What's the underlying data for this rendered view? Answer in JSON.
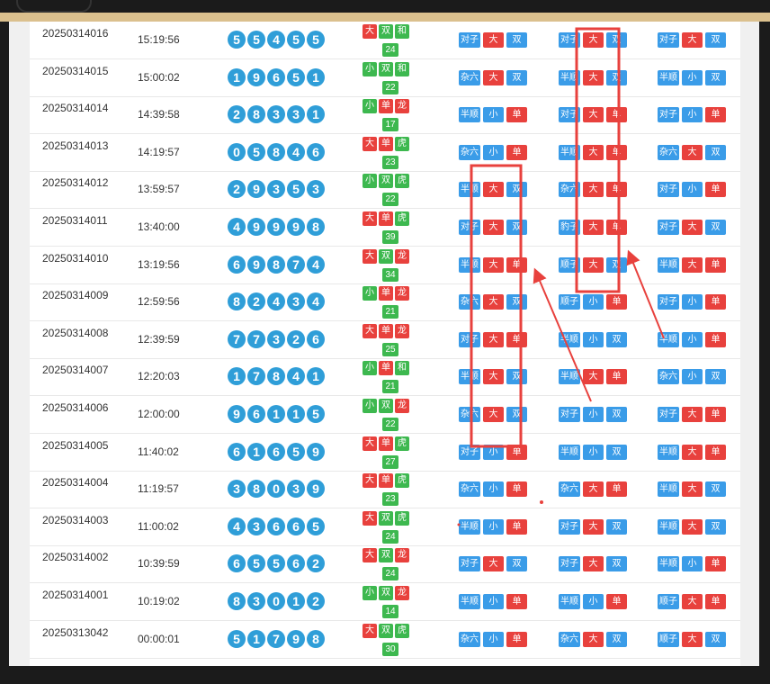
{
  "colors": {
    "red": "#e8413d",
    "blue": "#3a9ce8",
    "green": "#3db84f",
    "ball": "#2f9ed8",
    "highlight": "#e8413d"
  },
  "rows": [
    {
      "issue": "20250314016",
      "time": "15:19:56",
      "balls": [
        "5",
        "5",
        "4",
        "5",
        "5"
      ],
      "attr": [
        [
          "大",
          "red"
        ],
        [
          "双",
          "green"
        ],
        [
          "和",
          "green"
        ]
      ],
      "sum": "24",
      "g1": [
        [
          "对子",
          "blue"
        ],
        [
          "大",
          "red"
        ],
        [
          "双",
          "blue"
        ]
      ],
      "g2": [
        [
          "对子",
          "blue"
        ],
        [
          "大",
          "red"
        ],
        [
          "双",
          "blue"
        ]
      ],
      "g3": [
        [
          "对子",
          "blue"
        ],
        [
          "大",
          "red"
        ],
        [
          "双",
          "blue"
        ]
      ]
    },
    {
      "issue": "20250314015",
      "time": "15:00:02",
      "balls": [
        "1",
        "9",
        "6",
        "5",
        "1"
      ],
      "attr": [
        [
          "小",
          "green"
        ],
        [
          "双",
          "green"
        ],
        [
          "和",
          "green"
        ]
      ],
      "sum": "22",
      "g1": [
        [
          "杂六",
          "blue"
        ],
        [
          "大",
          "red"
        ],
        [
          "双",
          "blue"
        ]
      ],
      "g2": [
        [
          "半顺",
          "blue"
        ],
        [
          "大",
          "red"
        ],
        [
          "双",
          "blue"
        ]
      ],
      "g3": [
        [
          "半顺",
          "blue"
        ],
        [
          "小",
          "blue"
        ],
        [
          "双",
          "blue"
        ]
      ]
    },
    {
      "issue": "20250314014",
      "time": "14:39:58",
      "balls": [
        "2",
        "8",
        "3",
        "3",
        "1"
      ],
      "attr": [
        [
          "小",
          "green"
        ],
        [
          "单",
          "red"
        ],
        [
          "龙",
          "red"
        ]
      ],
      "sum": "17",
      "g1": [
        [
          "半顺",
          "blue"
        ],
        [
          "小",
          "blue"
        ],
        [
          "单",
          "red"
        ]
      ],
      "g2": [
        [
          "对子",
          "blue"
        ],
        [
          "大",
          "red"
        ],
        [
          "单",
          "red"
        ]
      ],
      "g3": [
        [
          "对子",
          "blue"
        ],
        [
          "小",
          "blue"
        ],
        [
          "单",
          "red"
        ]
      ]
    },
    {
      "issue": "20250314013",
      "time": "14:19:57",
      "balls": [
        "0",
        "5",
        "8",
        "4",
        "6"
      ],
      "attr": [
        [
          "大",
          "red"
        ],
        [
          "单",
          "red"
        ],
        [
          "虎",
          "green"
        ]
      ],
      "sum": "23",
      "g1": [
        [
          "杂六",
          "blue"
        ],
        [
          "小",
          "blue"
        ],
        [
          "单",
          "red"
        ]
      ],
      "g2": [
        [
          "半顺",
          "blue"
        ],
        [
          "大",
          "red"
        ],
        [
          "单",
          "red"
        ]
      ],
      "g3": [
        [
          "杂六",
          "blue"
        ],
        [
          "大",
          "red"
        ],
        [
          "双",
          "blue"
        ]
      ]
    },
    {
      "issue": "20250314012",
      "time": "13:59:57",
      "balls": [
        "2",
        "9",
        "3",
        "5",
        "3"
      ],
      "attr": [
        [
          "小",
          "green"
        ],
        [
          "双",
          "green"
        ],
        [
          "虎",
          "green"
        ]
      ],
      "sum": "22",
      "g1": [
        [
          "半顺",
          "blue"
        ],
        [
          "大",
          "red"
        ],
        [
          "双",
          "blue"
        ]
      ],
      "g2": [
        [
          "杂六",
          "blue"
        ],
        [
          "大",
          "red"
        ],
        [
          "单",
          "red"
        ]
      ],
      "g3": [
        [
          "对子",
          "blue"
        ],
        [
          "小",
          "blue"
        ],
        [
          "单",
          "red"
        ]
      ]
    },
    {
      "issue": "20250314011",
      "time": "13:40:00",
      "balls": [
        "4",
        "9",
        "9",
        "9",
        "8"
      ],
      "attr": [
        [
          "大",
          "red"
        ],
        [
          "单",
          "red"
        ],
        [
          "虎",
          "green"
        ]
      ],
      "sum": "39",
      "g1": [
        [
          "对子",
          "blue"
        ],
        [
          "大",
          "red"
        ],
        [
          "双",
          "blue"
        ]
      ],
      "g2": [
        [
          "豹子",
          "blue"
        ],
        [
          "大",
          "red"
        ],
        [
          "单",
          "red"
        ]
      ],
      "g3": [
        [
          "对子",
          "blue"
        ],
        [
          "大",
          "red"
        ],
        [
          "双",
          "blue"
        ]
      ]
    },
    {
      "issue": "20250314010",
      "time": "13:19:56",
      "balls": [
        "6",
        "9",
        "8",
        "7",
        "4"
      ],
      "attr": [
        [
          "大",
          "red"
        ],
        [
          "双",
          "green"
        ],
        [
          "龙",
          "red"
        ]
      ],
      "sum": "34",
      "g1": [
        [
          "半顺",
          "blue"
        ],
        [
          "大",
          "red"
        ],
        [
          "单",
          "red"
        ]
      ],
      "g2": [
        [
          "顺子",
          "blue"
        ],
        [
          "大",
          "red"
        ],
        [
          "双",
          "blue"
        ]
      ],
      "g3": [
        [
          "半顺",
          "blue"
        ],
        [
          "大",
          "red"
        ],
        [
          "单",
          "red"
        ]
      ]
    },
    {
      "issue": "20250314009",
      "time": "12:59:56",
      "balls": [
        "8",
        "2",
        "4",
        "3",
        "4"
      ],
      "attr": [
        [
          "小",
          "green"
        ],
        [
          "单",
          "red"
        ],
        [
          "龙",
          "red"
        ]
      ],
      "sum": "21",
      "g1": [
        [
          "杂六",
          "blue"
        ],
        [
          "大",
          "red"
        ],
        [
          "双",
          "blue"
        ]
      ],
      "g2": [
        [
          "顺子",
          "blue"
        ],
        [
          "小",
          "blue"
        ],
        [
          "单",
          "red"
        ]
      ],
      "g3": [
        [
          "对子",
          "blue"
        ],
        [
          "小",
          "blue"
        ],
        [
          "单",
          "red"
        ]
      ]
    },
    {
      "issue": "20250314008",
      "time": "12:39:59",
      "balls": [
        "7",
        "7",
        "3",
        "2",
        "6"
      ],
      "attr": [
        [
          "大",
          "red"
        ],
        [
          "单",
          "red"
        ],
        [
          "龙",
          "red"
        ]
      ],
      "sum": "25",
      "g1": [
        [
          "对子",
          "blue"
        ],
        [
          "大",
          "red"
        ],
        [
          "单",
          "red"
        ]
      ],
      "g2": [
        [
          "半顺",
          "blue"
        ],
        [
          "小",
          "blue"
        ],
        [
          "双",
          "blue"
        ]
      ],
      "g3": [
        [
          "半顺",
          "blue"
        ],
        [
          "小",
          "blue"
        ],
        [
          "单",
          "red"
        ]
      ]
    },
    {
      "issue": "20250314007",
      "time": "12:20:03",
      "balls": [
        "1",
        "7",
        "8",
        "4",
        "1"
      ],
      "attr": [
        [
          "小",
          "green"
        ],
        [
          "单",
          "red"
        ],
        [
          "和",
          "green"
        ]
      ],
      "sum": "21",
      "g1": [
        [
          "半顺",
          "blue"
        ],
        [
          "大",
          "red"
        ],
        [
          "双",
          "blue"
        ]
      ],
      "g2": [
        [
          "半顺",
          "blue"
        ],
        [
          "大",
          "red"
        ],
        [
          "单",
          "red"
        ]
      ],
      "g3": [
        [
          "杂六",
          "blue"
        ],
        [
          "小",
          "blue"
        ],
        [
          "双",
          "blue"
        ]
      ]
    },
    {
      "issue": "20250314006",
      "time": "12:00:00",
      "balls": [
        "9",
        "6",
        "1",
        "1",
        "5"
      ],
      "attr": [
        [
          "小",
          "green"
        ],
        [
          "双",
          "green"
        ],
        [
          "龙",
          "red"
        ]
      ],
      "sum": "22",
      "g1": [
        [
          "杂六",
          "blue"
        ],
        [
          "大",
          "red"
        ],
        [
          "双",
          "blue"
        ]
      ],
      "g2": [
        [
          "对子",
          "blue"
        ],
        [
          "小",
          "blue"
        ],
        [
          "双",
          "blue"
        ]
      ],
      "g3": [
        [
          "对子",
          "blue"
        ],
        [
          "大",
          "red"
        ],
        [
          "单",
          "red"
        ]
      ]
    },
    {
      "issue": "20250314005",
      "time": "11:40:02",
      "balls": [
        "6",
        "1",
        "6",
        "5",
        "9"
      ],
      "attr": [
        [
          "大",
          "red"
        ],
        [
          "单",
          "red"
        ],
        [
          "虎",
          "green"
        ]
      ],
      "sum": "27",
      "g1": [
        [
          "对子",
          "blue"
        ],
        [
          "小",
          "blue"
        ],
        [
          "单",
          "red"
        ]
      ],
      "g2": [
        [
          "半顺",
          "blue"
        ],
        [
          "小",
          "blue"
        ],
        [
          "双",
          "blue"
        ]
      ],
      "g3": [
        [
          "半顺",
          "blue"
        ],
        [
          "大",
          "red"
        ],
        [
          "单",
          "red"
        ]
      ]
    },
    {
      "issue": "20250314004",
      "time": "11:19:57",
      "balls": [
        "3",
        "8",
        "0",
        "3",
        "9"
      ],
      "attr": [
        [
          "大",
          "red"
        ],
        [
          "单",
          "red"
        ],
        [
          "虎",
          "green"
        ]
      ],
      "sum": "23",
      "g1": [
        [
          "杂六",
          "blue"
        ],
        [
          "小",
          "blue"
        ],
        [
          "单",
          "red"
        ]
      ],
      "g2": [
        [
          "杂六",
          "blue"
        ],
        [
          "大",
          "red"
        ],
        [
          "单",
          "red"
        ]
      ],
      "g3": [
        [
          "半顺",
          "blue"
        ],
        [
          "大",
          "red"
        ],
        [
          "双",
          "blue"
        ]
      ]
    },
    {
      "issue": "20250314003",
      "time": "11:00:02",
      "balls": [
        "4",
        "3",
        "6",
        "6",
        "5"
      ],
      "attr": [
        [
          "大",
          "red"
        ],
        [
          "双",
          "green"
        ],
        [
          "虎",
          "green"
        ]
      ],
      "sum": "24",
      "g1": [
        [
          "半顺",
          "blue"
        ],
        [
          "小",
          "blue"
        ],
        [
          "单",
          "red"
        ]
      ],
      "g2": [
        [
          "对子",
          "blue"
        ],
        [
          "大",
          "red"
        ],
        [
          "双",
          "blue"
        ]
      ],
      "g3": [
        [
          "半顺",
          "blue"
        ],
        [
          "大",
          "red"
        ],
        [
          "双",
          "blue"
        ]
      ]
    },
    {
      "issue": "20250314002",
      "time": "10:39:59",
      "balls": [
        "6",
        "5",
        "5",
        "6",
        "2"
      ],
      "attr": [
        [
          "大",
          "red"
        ],
        [
          "双",
          "green"
        ],
        [
          "龙",
          "red"
        ]
      ],
      "sum": "24",
      "g1": [
        [
          "对子",
          "blue"
        ],
        [
          "大",
          "red"
        ],
        [
          "双",
          "blue"
        ]
      ],
      "g2": [
        [
          "对子",
          "blue"
        ],
        [
          "大",
          "red"
        ],
        [
          "双",
          "blue"
        ]
      ],
      "g3": [
        [
          "半顺",
          "blue"
        ],
        [
          "小",
          "blue"
        ],
        [
          "单",
          "red"
        ]
      ]
    },
    {
      "issue": "20250314001",
      "time": "10:19:02",
      "balls": [
        "8",
        "3",
        "0",
        "1",
        "2"
      ],
      "attr": [
        [
          "小",
          "green"
        ],
        [
          "双",
          "green"
        ],
        [
          "龙",
          "red"
        ]
      ],
      "sum": "14",
      "g1": [
        [
          "半顺",
          "blue"
        ],
        [
          "小",
          "blue"
        ],
        [
          "单",
          "red"
        ]
      ],
      "g2": [
        [
          "半顺",
          "blue"
        ],
        [
          "小",
          "blue"
        ],
        [
          "单",
          "red"
        ]
      ],
      "g3": [
        [
          "顺子",
          "blue"
        ],
        [
          "大",
          "red"
        ],
        [
          "单",
          "red"
        ]
      ]
    },
    {
      "issue": "20250313042",
      "time": "00:00:01",
      "balls": [
        "5",
        "1",
        "7",
        "9",
        "8"
      ],
      "attr": [
        [
          "大",
          "red"
        ],
        [
          "双",
          "green"
        ],
        [
          "虎",
          "green"
        ]
      ],
      "sum": "30",
      "g1": [
        [
          "杂六",
          "blue"
        ],
        [
          "小",
          "blue"
        ],
        [
          "单",
          "red"
        ]
      ],
      "g2": [
        [
          "杂六",
          "blue"
        ],
        [
          "大",
          "red"
        ],
        [
          "双",
          "blue"
        ]
      ],
      "g3": [
        [
          "顺子",
          "blue"
        ],
        [
          "大",
          "red"
        ],
        [
          "双",
          "blue"
        ]
      ]
    }
  ]
}
